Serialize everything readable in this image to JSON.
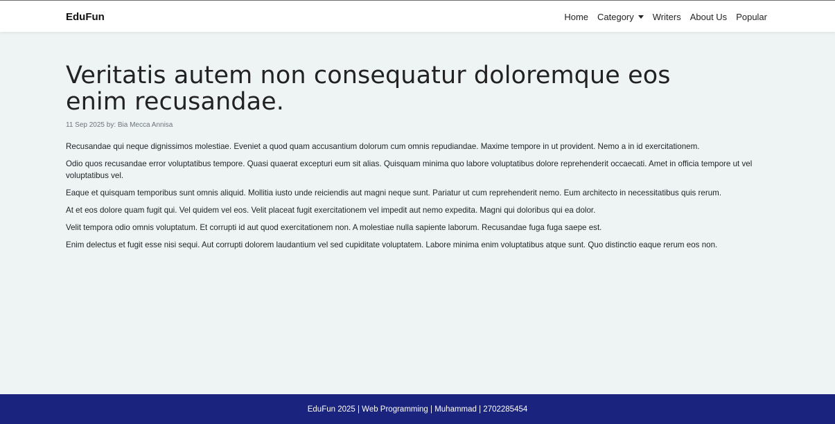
{
  "nav": {
    "brand": "EduFun",
    "links": [
      "Home",
      "Category",
      "Writers",
      "About Us",
      "Popular"
    ]
  },
  "article": {
    "title": "Veritatis autem non consequatur doloremque eos enim recusandae.",
    "meta": "11 Sep 2025 by: Bia Mecca Annisa",
    "paragraphs": [
      "Recusandae qui neque dignissimos molestiae. Eveniet a quod quam accusantium dolorum cum omnis repudiandae. Maxime tempore in ut provident. Nemo a in id exercitationem.",
      "Odio quos recusandae error voluptatibus tempore. Quasi quaerat excepturi eum sit alias. Quisquam minima quo labore voluptatibus dolore reprehenderit occaecati. Amet in officia tempore ut vel voluptatibus vel.",
      "Eaque et quisquam temporibus sunt omnis aliquid. Mollitia iusto unde reiciendis aut magni neque sunt. Pariatur ut cum reprehenderit nemo. Eum architecto in necessitatibus quis rerum.",
      "At et eos dolore quam fugit qui. Vel quidem vel eos. Velit placeat fugit exercitationem vel impedit aut nemo expedita. Magni qui doloribus qui ea dolor.",
      "Velit tempora odio omnis voluptatum. Et corrupti id aut quod exercitationem non. A molestiae nulla sapiente laborum. Recusandae fuga fuga saepe est.",
      "Enim delectus et fugit esse nisi sequi. Aut corrupti dolorem laudantium vel sed cupiditate voluptatem. Labore minima enim voluptatibus atque sunt. Quo distinctio eaque rerum eos non."
    ]
  },
  "footer": {
    "text": "EduFun 2025 | Web Programming | Muhammad | 2702285454"
  },
  "colors": {
    "footer_bg": "#1a237e",
    "page_bg": "#eef3f3"
  }
}
